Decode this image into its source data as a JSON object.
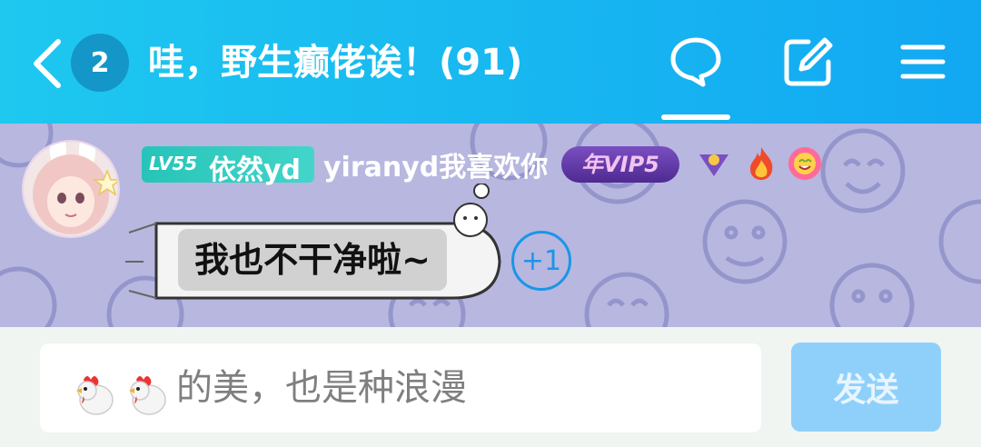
{
  "header": {
    "unread_count": "2",
    "title": "哇，野生癫佬诶！(91)",
    "icons": [
      "back-arrow-icon",
      "chat-bubble-icon",
      "edit-icon",
      "menu-icon"
    ]
  },
  "message": {
    "level": "LV55",
    "level_name": "依然yd",
    "username": "yiranyd我喜欢你",
    "vip_badge": "年VIP5",
    "text": "我也不干净啦~",
    "reaction": "+1"
  },
  "composer": {
    "draft_text": "的美，也是种浪漫",
    "draft_emojis": [
      "rooster-emoji",
      "rooster-emoji"
    ],
    "send_label": "发送"
  },
  "colors": {
    "header_gradient_start": "#1ec8ef",
    "header_gradient_end": "#12a8f2",
    "message_background": "#b7b7e0",
    "level_badge": "#2ec8bd",
    "vip_badge": "#5a3399",
    "reaction_accent": "#1a96e6",
    "send_button": "#8fd0fb"
  }
}
